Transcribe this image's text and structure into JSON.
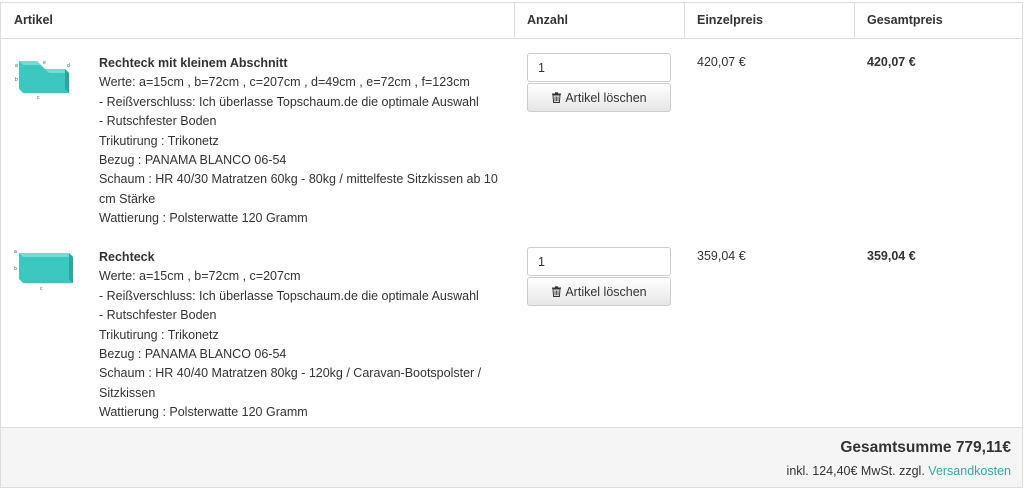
{
  "header": {
    "col_article": "Artikel",
    "col_quantity": "Anzahl",
    "col_unit_price": "Einzelpreis",
    "col_total_price": "Gesamtpreis"
  },
  "items": [
    {
      "name": "Rechteck mit kleinem Abschnitt",
      "details": [
        "Werte: a=15cm , b=72cm , c=207cm , d=49cm , e=72cm , f=123cm",
        "- Reißverschluss: Ich überlasse Topschaum.de die optimale Auswahl",
        "- Rutschfester Boden",
        "Trikutirung : Trikonetz",
        "Bezug : PANAMA BLANCO 06-54",
        "Schaum : HR 40/30 Matratzen 60kg - 80kg / mittelfeste Sitzkissen ab 10 cm Stärke",
        "Wattierung : Polsterwatte 120 Gramm"
      ],
      "quantity": "1",
      "delete_label": "Artikel löschen",
      "unit_price": "420,07 €",
      "total_price": "420,07 €",
      "thumb_labels": [
        "a",
        "b",
        "c",
        "d",
        "e"
      ]
    },
    {
      "name": "Rechteck",
      "details": [
        "Werte: a=15cm , b=72cm , c=207cm",
        "- Reißverschluss: Ich überlasse Topschaum.de die optimale Auswahl",
        "- Rutschfester Boden",
        "Trikutirung : Trikonetz",
        "Bezug : PANAMA BLANCO 06-54",
        "Schaum : HR 40/40 Matratzen 80kg - 120kg / Caravan-Bootspolster / Sitzkissen",
        "Wattierung : Polsterwatte 120 Gramm"
      ],
      "quantity": "1",
      "delete_label": "Artikel löschen",
      "unit_price": "359,04 €",
      "total_price": "359,04 €",
      "thumb_labels": [
        "a",
        "b",
        "c"
      ]
    }
  ],
  "footer": {
    "grand_total": "Gesamtsumme 779,11€",
    "vat_text": "inkl. 124,40€ MwSt. zzgl.",
    "shipping_link": "Versandkosten"
  },
  "colors": {
    "foam": "#3cc8c0",
    "link": "#3aa7a0",
    "border": "#dddddd"
  },
  "icons": {
    "delete": "trash-icon"
  }
}
